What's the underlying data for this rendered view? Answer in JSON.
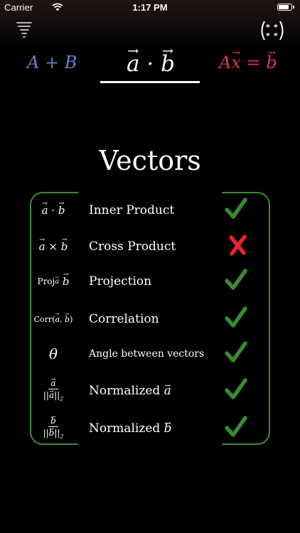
{
  "status_bar": {
    "carrier": "Carrier",
    "time": "1:17 PM"
  },
  "header": {
    "left_icon": "tornado-icon",
    "right_icon": "operators-grid-icon"
  },
  "tabs": [
    {
      "label": "A + B",
      "selected": false,
      "color": "#5f84c4"
    },
    {
      "label": "a · b",
      "selected": true,
      "color": "#ffffff"
    },
    {
      "label": "Ax = b",
      "selected": false,
      "color": "#d23a5a"
    }
  ],
  "page_title": "Vectors",
  "colors": {
    "frame": "#3f8a36",
    "check": "#3a8a30",
    "cross": "#e8222f"
  },
  "operations": [
    {
      "symbol": "a · b",
      "label": "Inner Product",
      "supported": true,
      "status_icon": "checkmark-icon"
    },
    {
      "symbol": "a × b",
      "label": "Cross Product",
      "supported": false,
      "status_icon": "cross-icon"
    },
    {
      "symbol": "Proj_a b",
      "label": "Projection",
      "supported": true,
      "status_icon": "checkmark-icon"
    },
    {
      "symbol": "Corr(a, b)",
      "label": "Correlation",
      "supported": true,
      "status_icon": "checkmark-icon"
    },
    {
      "symbol": "θ",
      "label": "Angle between vectors",
      "supported": true,
      "status_icon": "checkmark-icon"
    },
    {
      "symbol": "a / ||a||_2",
      "label": "Normalized a",
      "supported": true,
      "status_icon": "checkmark-icon"
    },
    {
      "symbol": "b / ||b||_2",
      "label": "Normalized b",
      "supported": true,
      "status_icon": "checkmark-icon"
    }
  ]
}
